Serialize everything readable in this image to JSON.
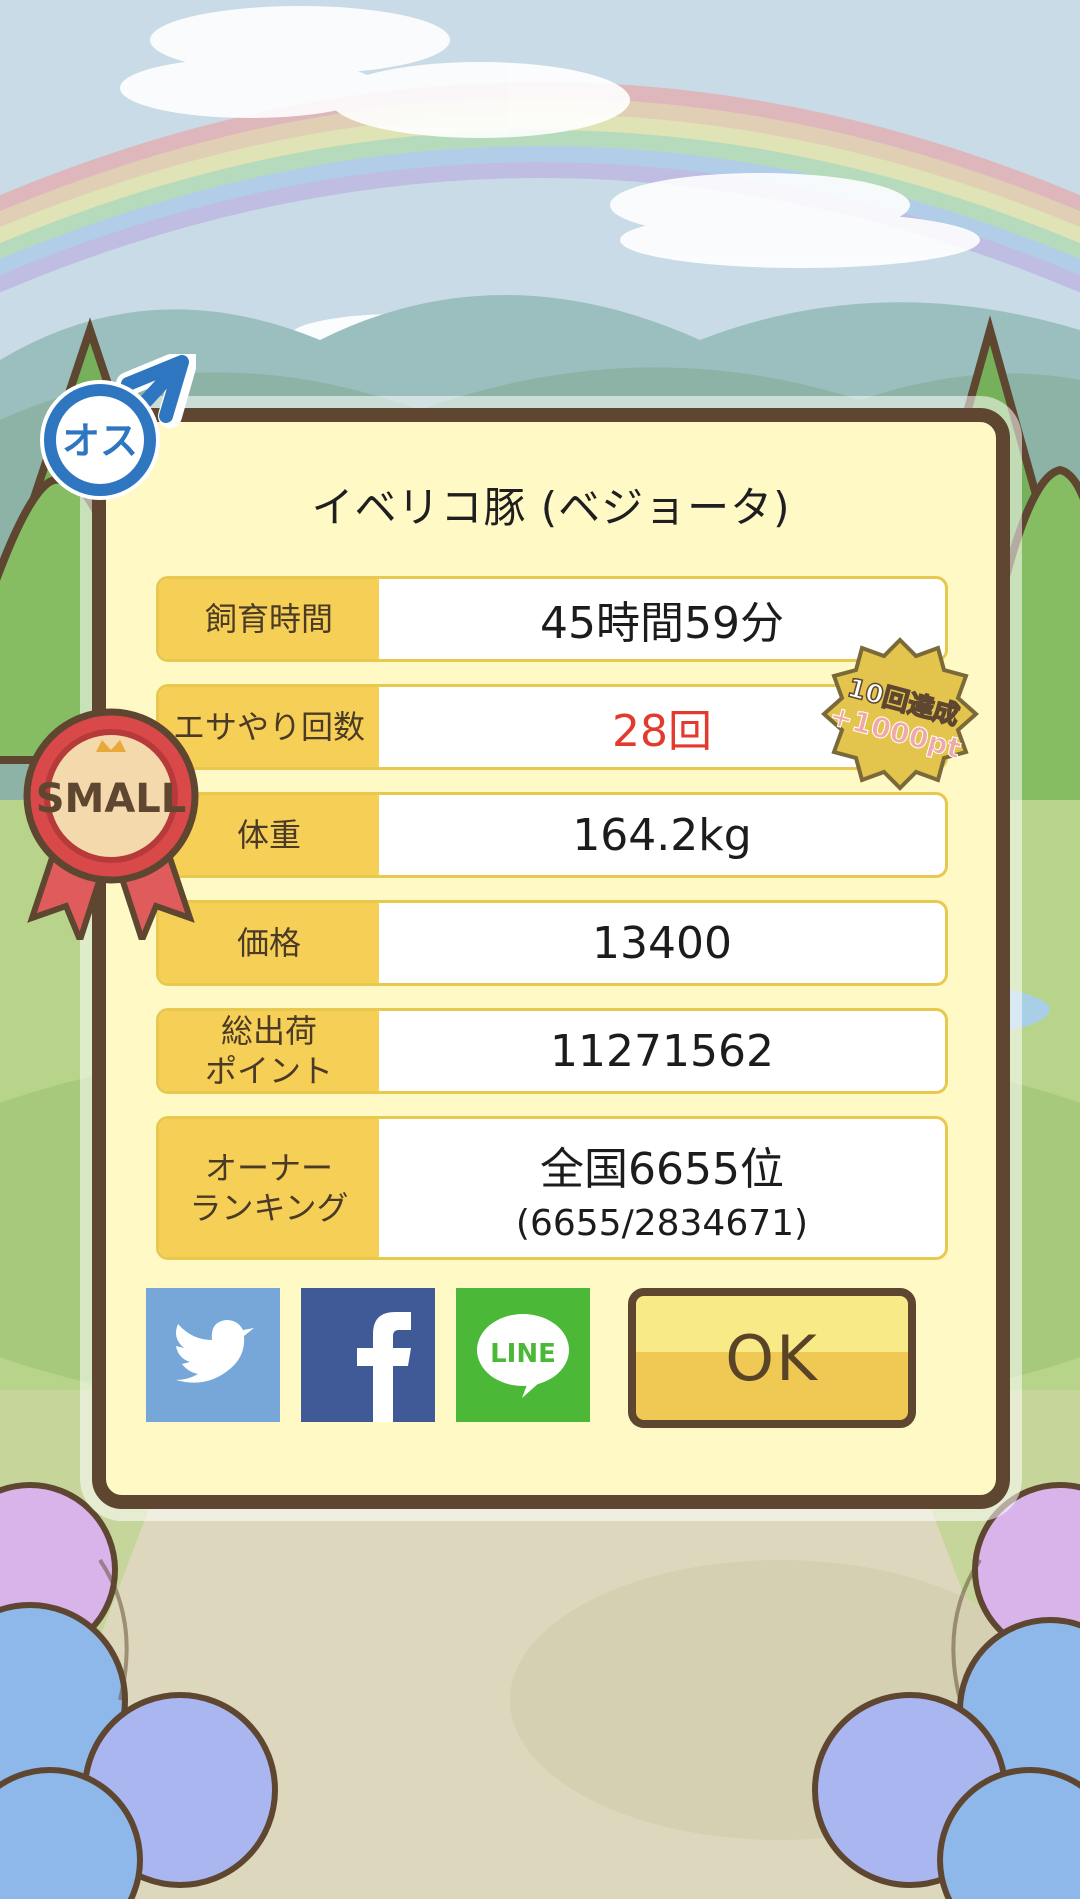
{
  "dialog": {
    "title": "イベリコ豚 (ベジョータ)",
    "rows": [
      {
        "label": "飼育時間",
        "value": "45時間59分"
      },
      {
        "label": "エサやり回数",
        "value": "28回"
      },
      {
        "label": "体重",
        "value": "164.2kg"
      },
      {
        "label": "価格",
        "value": "13400"
      },
      {
        "label": "総出荷\nポイント",
        "value": "11271562"
      },
      {
        "label": "オーナー\nランキング",
        "value": "全国6655位",
        "sub": "(6655/2834671)"
      }
    ],
    "buttons": {
      "twitter": "twitter",
      "facebook": "facebook",
      "line": "LINE",
      "ok": "OK"
    }
  },
  "badges": {
    "gender": "オス",
    "size": "SMALL",
    "bonus_line1": "10回達成",
    "bonus_line2": "+1000pt"
  },
  "colors": {
    "twitter": "#76a7d8",
    "facebook": "#3f5a96",
    "line": "#4cb837",
    "accent_red": "#e33a2e",
    "frame": "#5e4630"
  }
}
